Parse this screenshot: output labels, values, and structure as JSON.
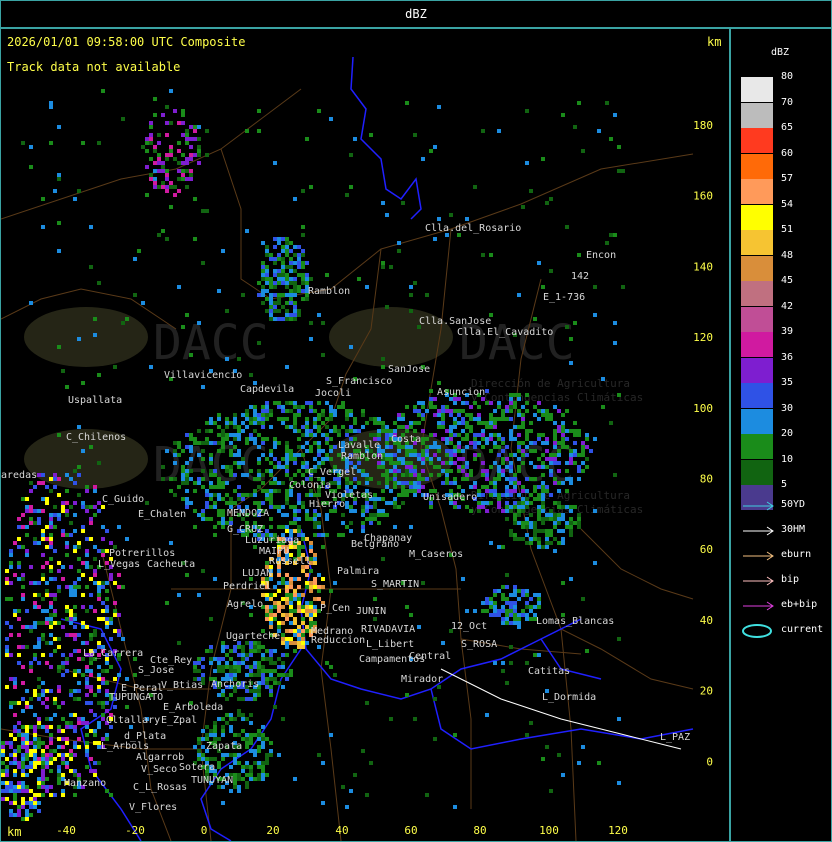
{
  "window": {
    "title": "dBZ"
  },
  "map": {
    "timestamp": "2026/01/01 09:58:00 UTC Composite",
    "status": "Track data not available",
    "km_top": "km",
    "km_bottom": "km",
    "x_ticks": [
      "-40",
      "-20",
      "0",
      "20",
      "40",
      "60",
      "80",
      "100",
      "120"
    ],
    "y_ticks": [
      "180",
      "160",
      "140",
      "120",
      "100",
      "80",
      "60",
      "40",
      "20",
      "0"
    ],
    "watermark": {
      "main": "DACC",
      "sub1": "Dirección de Agricultura",
      "sub2": "y Contingencias Climáticas"
    },
    "places": [
      {
        "name": "Clla.del_Rosario"
      },
      {
        "name": "Encon"
      },
      {
        "name": "142"
      },
      {
        "name": "E_1-736"
      },
      {
        "name": "Ramblon"
      },
      {
        "name": "Clla.SanJose"
      },
      {
        "name": "Clla.El_Cavadito"
      },
      {
        "name": "Villavicencio"
      },
      {
        "name": "Capdevila"
      },
      {
        "name": "S_Francisco"
      },
      {
        "name": "Jocoli"
      },
      {
        "name": "SanJose"
      },
      {
        "name": "Asuncion"
      },
      {
        "name": "Uspallata"
      },
      {
        "name": "C_Chilenos"
      },
      {
        "name": "aredas"
      },
      {
        "name": "Lavalle"
      },
      {
        "name": "C_Vergel"
      },
      {
        "name": "Costa"
      },
      {
        "name": "Colonia"
      },
      {
        "name": "Violetas"
      },
      {
        "name": "Ramblon"
      },
      {
        "name": "Hierro"
      },
      {
        "name": "Unisadero"
      },
      {
        "name": "C_Guido"
      },
      {
        "name": "E_Chalen"
      },
      {
        "name": "MENDOZA"
      },
      {
        "name": "G_CRUZ"
      },
      {
        "name": "Luzuriaga"
      },
      {
        "name": "Chapanay"
      },
      {
        "name": "Belgrano"
      },
      {
        "name": "M_Caseros"
      },
      {
        "name": "Potrerillos"
      },
      {
        "name": "Cacheuta"
      },
      {
        "name": "L_Vegas"
      },
      {
        "name": "MAIPU"
      },
      {
        "name": "Russell"
      },
      {
        "name": "Palmira"
      },
      {
        "name": "LUJAN"
      },
      {
        "name": "Perdriel"
      },
      {
        "name": "S_MARTIN"
      },
      {
        "name": "Agrelo"
      },
      {
        "name": "P_Cen"
      },
      {
        "name": "JUNIN"
      },
      {
        "name": "Ugarteche"
      },
      {
        "name": "Medrano"
      },
      {
        "name": "RIVADAVIA"
      },
      {
        "name": "Reduccion"
      },
      {
        "name": "L_Libert"
      },
      {
        "name": "12_Oct"
      },
      {
        "name": "S_ROSA"
      },
      {
        "name": "Lomas_Blancas"
      },
      {
        "name": "La_Carrera"
      },
      {
        "name": "Cte_Rey"
      },
      {
        "name": "S_Jose"
      },
      {
        "name": "E_Peral"
      },
      {
        "name": "V_Btias"
      },
      {
        "name": "Anchoris"
      },
      {
        "name": "Campamentos"
      },
      {
        "name": "Central"
      },
      {
        "name": "Catitas"
      },
      {
        "name": "TUPUNGATO"
      },
      {
        "name": "Mirador"
      },
      {
        "name": "L_Dormida"
      },
      {
        "name": "E_Arboleda"
      },
      {
        "name": "Gltallary"
      },
      {
        "name": "E_Zpal"
      },
      {
        "name": "d_Plata"
      },
      {
        "name": "L_Arbols"
      },
      {
        "name": "Zapata"
      },
      {
        "name": "Algarrob"
      },
      {
        "name": "Sotera"
      },
      {
        "name": "V_Seco"
      },
      {
        "name": "C_L_Rosas"
      },
      {
        "name": "TUNUYAN"
      },
      {
        "name": "Manzano"
      },
      {
        "name": "V_Flores"
      },
      {
        "name": "L_PAZ"
      }
    ]
  },
  "legend": {
    "title": "dBZ",
    "scale": [
      {
        "label": "80",
        "color": "#e8e8e8"
      },
      {
        "label": "70",
        "color": "#bcbcbc"
      },
      {
        "label": "65",
        "color": "#ff3a1f"
      },
      {
        "label": "60",
        "color": "#ff6a08"
      },
      {
        "label": "57",
        "color": "#ff9a5a"
      },
      {
        "label": "54",
        "color": "#ffff00"
      },
      {
        "label": "51",
        "color": "#f6c432"
      },
      {
        "label": "48",
        "color": "#d98e3a"
      },
      {
        "label": "45",
        "color": "#c07080"
      },
      {
        "label": "42",
        "color": "#c04e96"
      },
      {
        "label": "39",
        "color": "#d01aa0"
      },
      {
        "label": "36",
        "color": "#7e1ed0"
      },
      {
        "label": "35",
        "color": "#2f52e6"
      },
      {
        "label": "30",
        "color": "#1c8ce0"
      },
      {
        "label": "20",
        "color": "#1a8c1a"
      },
      {
        "label": "10",
        "color": "#116411"
      },
      {
        "label": "5",
        "color": "#4a3a8e"
      }
    ],
    "tracks": [
      {
        "label": "50YD",
        "color": "#40d0e0"
      },
      {
        "label": "30HM",
        "color": "#ffffff"
      },
      {
        "label": "eburn",
        "color": "#f4c080"
      },
      {
        "label": "bip",
        "color": "#ffc0c0"
      },
      {
        "label": "eb+bip",
        "color": "#e040e0"
      },
      {
        "label": "current",
        "color": "#40e0e0"
      }
    ]
  }
}
